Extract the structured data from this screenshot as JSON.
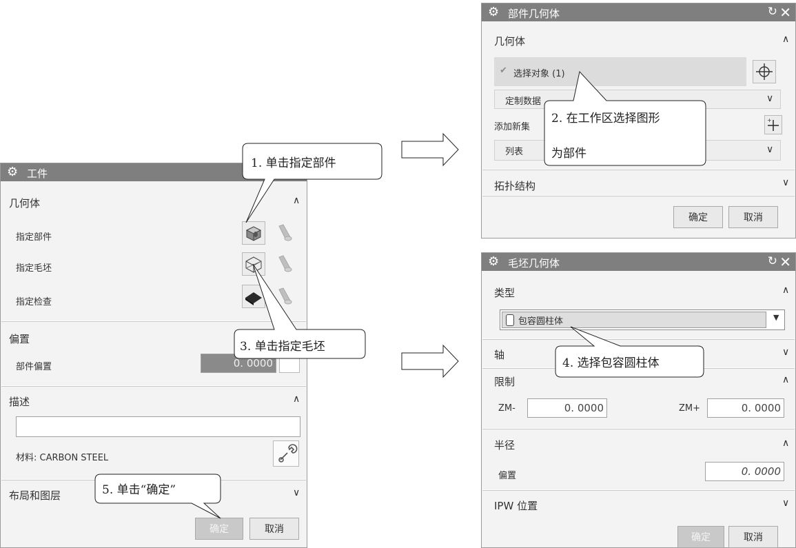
{
  "workpiece": {
    "title": "工件",
    "geometry_header": "几何体",
    "specify_part": "指定部件",
    "specify_blank": "指定毛坯",
    "specify_check": "指定检查",
    "offset_header": "偏置",
    "part_offset_label": "部件偏置",
    "part_offset_value": "0. 0000",
    "description_header": "描述",
    "description_value": "",
    "material": "材料: CARBON STEEL",
    "layout_header": "布局和图层",
    "ok": "确定",
    "cancel": "取消"
  },
  "part_geometry": {
    "title": "部件几何体",
    "geometry_header": "几何体",
    "select_object": "选择对象 (1)",
    "custom_data": "定制数据",
    "add_new_set": "添加新集",
    "list": "列表",
    "topology": "拓扑结构",
    "ok": "确定",
    "cancel": "取消"
  },
  "blank_geometry": {
    "title": "毛坯几何体",
    "type_header": "类型",
    "type_value": "包容圆柱体",
    "axis_header": "轴",
    "limits_header": "限制",
    "zm_minus_label": "ZM-",
    "zm_minus_value": "0. 0000",
    "zm_plus_label": "ZM+",
    "zm_plus_value": "0. 0000",
    "radius_header": "半径",
    "offset_label": "偏置",
    "offset_value": "0. 0000",
    "ipw_header": "IPW 位置",
    "ok": "确定",
    "cancel": "取消"
  },
  "callouts": {
    "c1": "1. 单击指定部件",
    "c2_line1": "2. 在工作区选择图形",
    "c2_line2": "为部件",
    "c3": "3. 单击指定毛坯",
    "c4": "4. 选择包容圆柱体",
    "c5": "5. 单击“确定”"
  },
  "icons": {
    "gear": "gear-icon",
    "reset": "reset-icon",
    "close": "close-icon",
    "chevron_up": "chevron-up-icon",
    "chevron_down": "chevron-down-icon",
    "part": "part-solid-icon",
    "blank": "blank-wireframe-icon",
    "check": "check-solid-icon",
    "display": "display-cone-icon",
    "crosshair": "crosshair-icon",
    "add_set": "add-set-icon",
    "wrench": "wrench-icon",
    "checkmark": "checkmark-icon",
    "cylinder": "cylinder-icon"
  }
}
